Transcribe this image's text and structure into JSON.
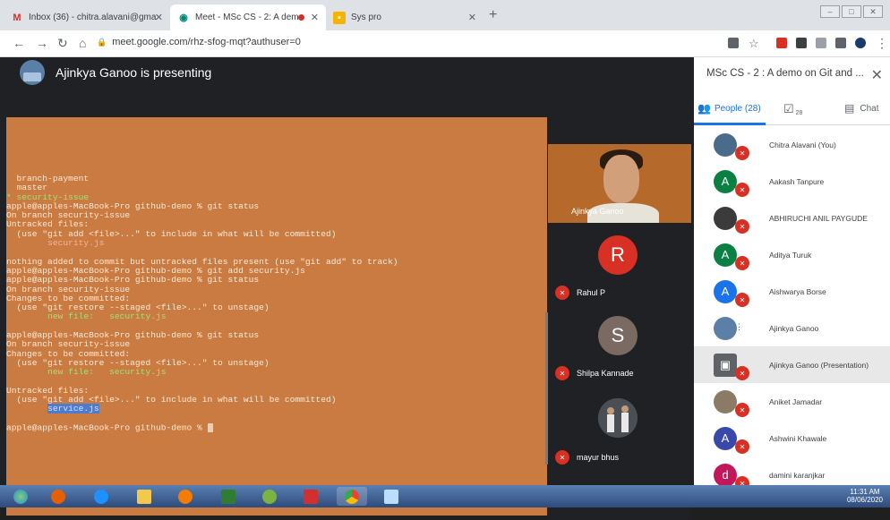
{
  "browser": {
    "tabs": [
      {
        "title": "Inbox (36) - chitra.alavani@gma",
        "icon": "gmail-icon",
        "active": false
      },
      {
        "title": "Meet - MSc CS - 2: A demo",
        "icon": "meet-icon",
        "active": true
      },
      {
        "title": "Sys pro",
        "icon": "slides-icon",
        "active": false
      }
    ],
    "url": "meet.google.com/rhz-sfog-mqt?authuser=0"
  },
  "meet": {
    "presenting_text": "Ajinkya Ganoo is presenting",
    "terminal_lines": [
      {
        "text": "  branch-payment",
        "style": "normal"
      },
      {
        "text": "  master",
        "style": "normal"
      },
      {
        "text": "* security-issue",
        "style": "green"
      },
      {
        "text": "apple@apples-MacBook-Pro github-demo % git status",
        "style": "normal"
      },
      {
        "text": "On branch security-issue",
        "style": "normal"
      },
      {
        "text": "Untracked files:",
        "style": "normal"
      },
      {
        "text": "  (use \"git add <file>...\" to include in what will be committed)",
        "style": "normal"
      },
      {
        "text": "        security.js",
        "style": "red"
      },
      {
        "text": "",
        "style": "normal"
      },
      {
        "text": "nothing added to commit but untracked files present (use \"git add\" to track)",
        "style": "normal"
      },
      {
        "text": "apple@apples-MacBook-Pro github-demo % git add security.js",
        "style": "normal"
      },
      {
        "text": "apple@apples-MacBook-Pro github-demo % git status",
        "style": "normal"
      },
      {
        "text": "On branch security-issue",
        "style": "normal"
      },
      {
        "text": "Changes to be committed:",
        "style": "normal"
      },
      {
        "text": "  (use \"git restore --staged <file>...\" to unstage)",
        "style": "normal"
      },
      {
        "text": "        new file:   security.js",
        "style": "green"
      },
      {
        "text": "",
        "style": "normal"
      },
      {
        "text": "apple@apples-MacBook-Pro github-demo % git status",
        "style": "normal"
      },
      {
        "text": "On branch security-issue",
        "style": "normal"
      },
      {
        "text": "Changes to be committed:",
        "style": "normal"
      },
      {
        "text": "  (use \"git restore --staged <file>...\" to unstage)",
        "style": "normal"
      },
      {
        "text": "        new file:   security.js",
        "style": "green"
      },
      {
        "text": "",
        "style": "normal"
      },
      {
        "text": "Untracked files:",
        "style": "normal"
      },
      {
        "text": "  (use \"git add <file>...\" to include in what will be committed)",
        "style": "normal"
      },
      {
        "text": "        service.js",
        "style": "highlight"
      },
      {
        "text": "",
        "style": "normal"
      },
      {
        "text": "apple@apples-MacBook-Pro github-demo % ",
        "style": "prompt"
      }
    ],
    "tiles": {
      "video_name": "Ajinkya Ganoo",
      "participants": [
        {
          "name": "Rahul P",
          "initial": "R",
          "color": "#d93025"
        },
        {
          "name": "Shilpa Kannade",
          "initial": "S",
          "color": "#7a6a62"
        },
        {
          "name": "mayur bhus",
          "initial": "",
          "color": "#5a5f66"
        }
      ]
    }
  },
  "panel": {
    "title": "MSc CS - 2 : A demo on Git and ...",
    "tabs": {
      "people": "People (28)",
      "tasks_count": "28",
      "chat": "Chat"
    },
    "people": [
      {
        "name": "Chitra Alavani (You)",
        "initial": "",
        "color": "#4a6b8a",
        "muted": true
      },
      {
        "name": "Aakash Tanpure",
        "initial": "A",
        "color": "#0b8043",
        "muted": true
      },
      {
        "name": "ABHIRUCHI ANIL PAYGUDE",
        "initial": "",
        "color": "#3b3b3b",
        "muted": true
      },
      {
        "name": "Aditya Turuk",
        "initial": "A",
        "color": "#0b8043",
        "muted": true
      },
      {
        "name": "Aishwarya Borse",
        "initial": "A",
        "color": "#1a73e8",
        "muted": true
      },
      {
        "name": "Ajinkya Ganoo",
        "initial": "",
        "color": "#5b7fa6",
        "muted": false
      },
      {
        "name": "Ajinkya Ganoo (Presentation)",
        "initial": "",
        "color": "#5f6368",
        "muted": true
      },
      {
        "name": "Aniket Jamadar",
        "initial": "",
        "color": "#8a7a66",
        "muted": true
      },
      {
        "name": "Ashwini Khawale",
        "initial": "A",
        "color": "#3949ab",
        "muted": true
      },
      {
        "name": "damini karanjkar",
        "initial": "d",
        "color": "#c2185b",
        "muted": true
      }
    ]
  },
  "taskbar": {
    "time": "11:31 AM",
    "date": "08/06/2020"
  }
}
